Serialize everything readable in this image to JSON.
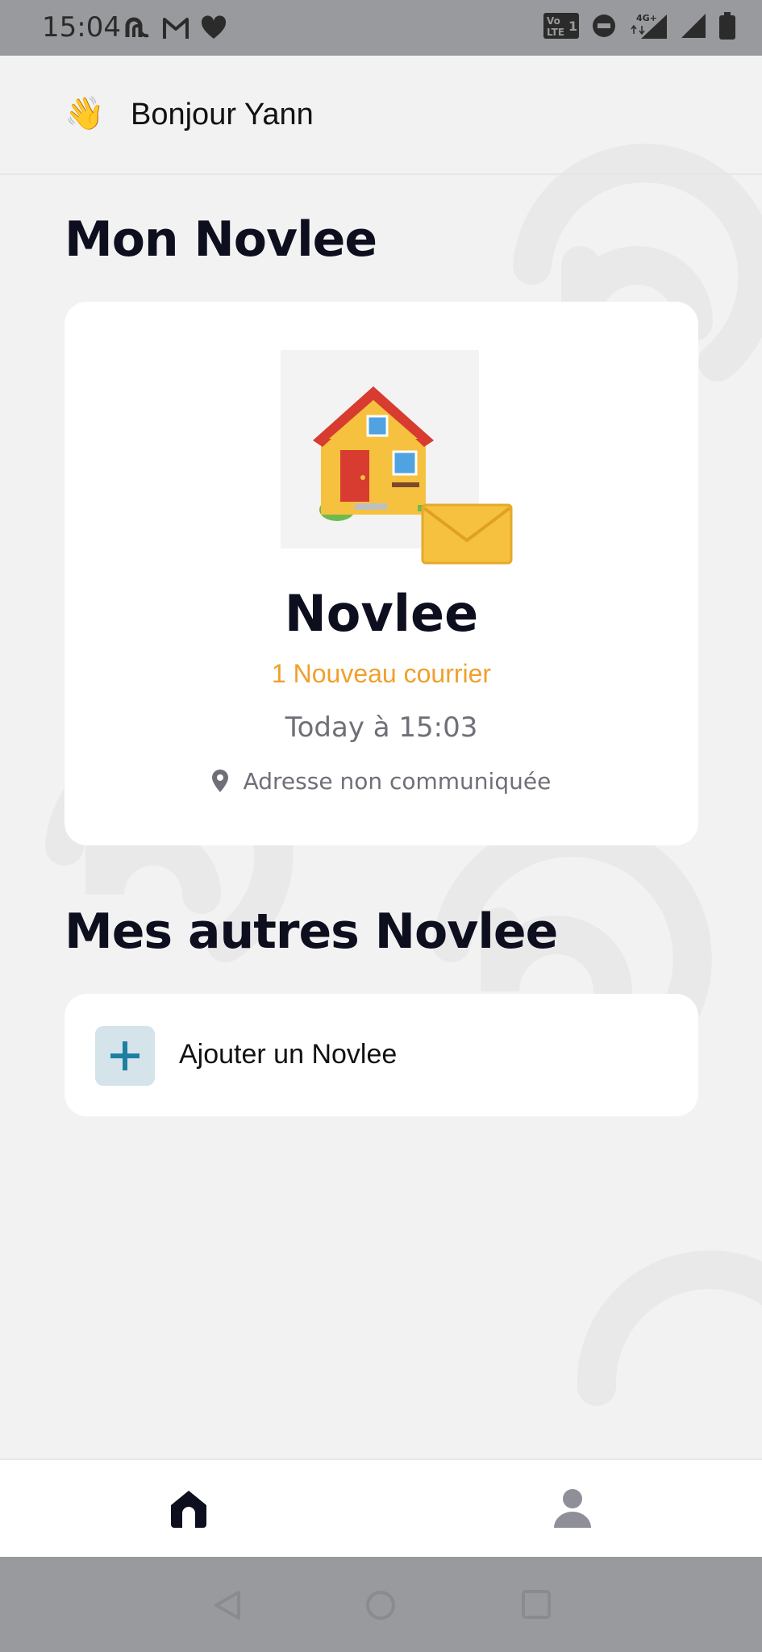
{
  "status_bar": {
    "time": "15:04",
    "left_icons": [
      "nfc-app-icon",
      "gmail-icon",
      "heart-icon"
    ],
    "right_icons": [
      "volte-icon",
      "do-not-disturb-icon",
      "signal-4g-icon",
      "signal-icon",
      "battery-icon"
    ],
    "network_label": "4G+",
    "volte_label": "Vo LTE"
  },
  "header": {
    "emoji": "👋",
    "greeting_prefix": "Bonjour",
    "user_name": "Yann"
  },
  "main_section": {
    "title": "Mon Novlee",
    "card": {
      "illustration": "house-with-envelope-icon",
      "name": "Novlee",
      "new_mail": "1 Nouveau courrier",
      "date": "Today à 15:03",
      "address": "Adresse non communiquée"
    }
  },
  "others_section": {
    "title": "Mes autres Novlee",
    "add_label": "Ajouter un Novlee"
  },
  "bottom_nav": {
    "items": [
      "home-icon",
      "profile-icon"
    ],
    "active": "home-icon"
  },
  "colors": {
    "background": "#f2f2f3",
    "accent_orange": "#f0a02c",
    "dark": "#0d0f1e",
    "muted": "#6f6f78",
    "add_button_bg": "#d4e4ea",
    "add_button_plus": "#1f7fa3"
  }
}
